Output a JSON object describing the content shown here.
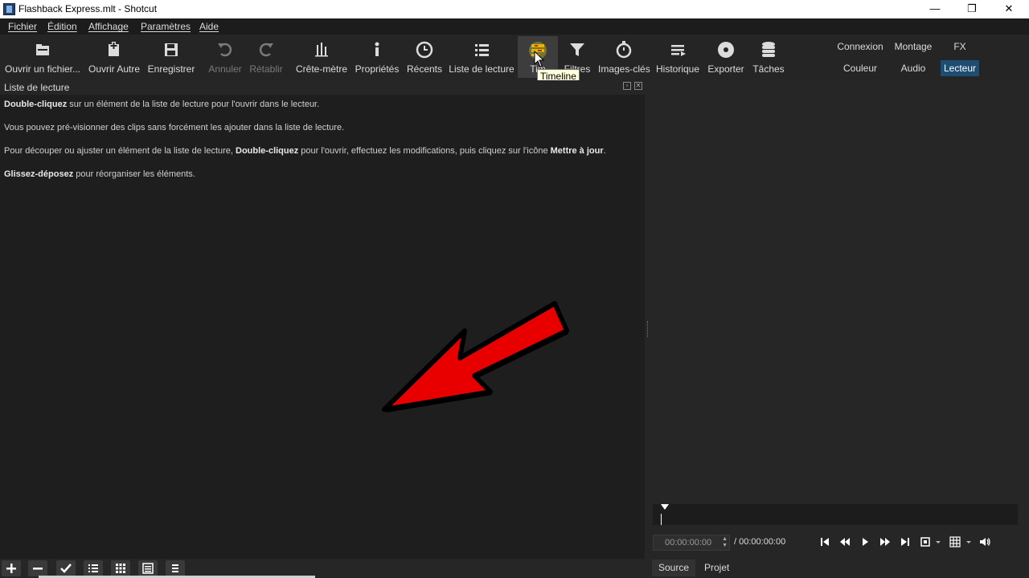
{
  "window": {
    "title": "Flashback Express.mlt - Shotcut",
    "minimize": "—",
    "maximize": "❐",
    "close": "✕"
  },
  "menu": [
    "Fichier",
    "Édition",
    "Affichage",
    "Paramètres",
    "Aide"
  ],
  "toolbar": {
    "open_file": "Ouvrir un fichier...",
    "open_other": "Ouvrir Autre",
    "save": "Enregistrer",
    "undo": "Annuler",
    "redo": "Rétablir",
    "peak_meter": "Crête-mètre",
    "properties": "Propriétés",
    "recent": "Récents",
    "playlist": "Liste de lecture",
    "timeline": "Tim",
    "filters": "Filtres",
    "keyframes": "Images-clés",
    "history": "Historique",
    "export": "Exporter",
    "jobs": "Tâches"
  },
  "layouts": {
    "logging": "Connexion",
    "editing": "Montage",
    "fx": "FX",
    "color": "Couleur",
    "audio": "Audio",
    "player": "Lecteur"
  },
  "tooltip": "Timeline",
  "playlist_panel": {
    "title": "Liste de lecture",
    "help": [
      {
        "bold": "Double-cliquez",
        "rest": " sur un élément de la liste de lecture pour l'ouvrir dans le lecteur."
      },
      {
        "plain": "Vous pouvez pré-visionner des clips sans forcément les ajouter dans la liste de lecture."
      },
      {
        "pre": "Pour découper ou ajuster un élément de la liste de lecture, ",
        "bold": "Double-cliquez",
        "mid": " pour l'ouvrir, effectuez les modifications, puis cliquez sur l'icône ",
        "bold2": "Mettre à jour",
        "end": "."
      },
      {
        "bold": "Glissez-déposez",
        "rest": " pour réorganiser les éléments."
      }
    ]
  },
  "player": {
    "position": "00:00:00:00",
    "duration": "/ 00:00:00:00"
  },
  "tabs": {
    "source": "Source",
    "project": "Projet"
  },
  "colors": {
    "accent": "#1e4d73",
    "arrow": "#e80000",
    "tooltip_bg": "#ffffdc"
  }
}
